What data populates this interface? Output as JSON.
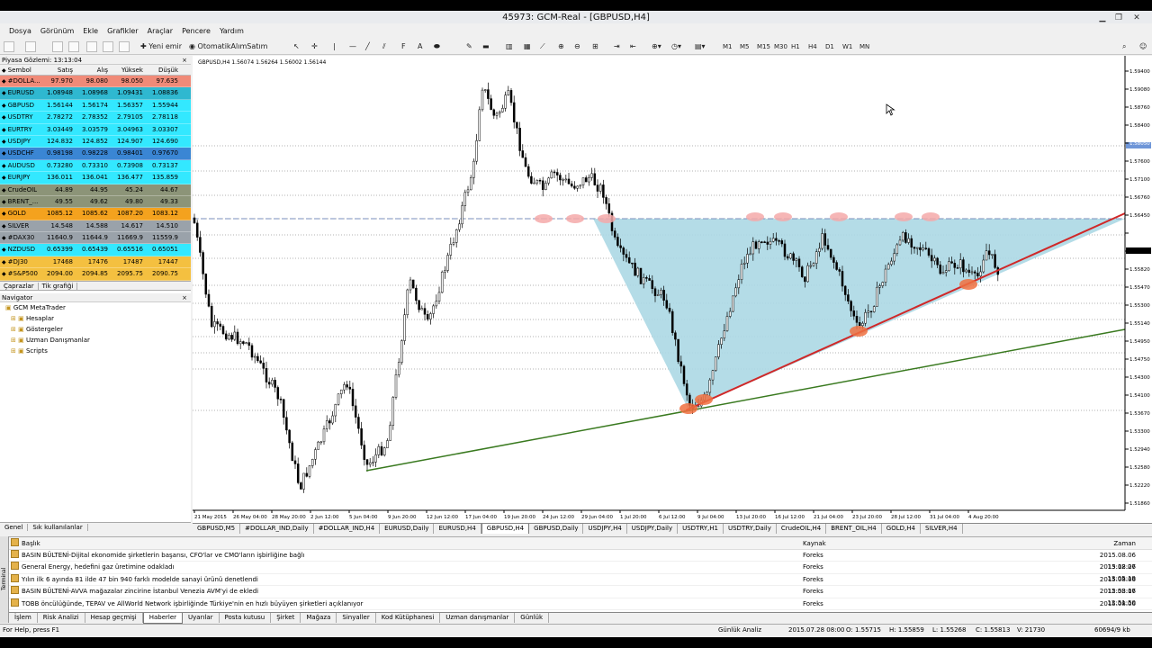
{
  "window": {
    "title": "45973: GCM-Real - [GBPUSD,H4]"
  },
  "menu": [
    "Dosya",
    "Görünüm",
    "Ekle",
    "Grafikler",
    "Araçlar",
    "Pencere",
    "Yardım"
  ],
  "toolbar": {
    "new_order": "Yeni emir",
    "auto_trading": "OtomatikAlımSatım",
    "timeframes": [
      "M1",
      "M5",
      "M15",
      "M30",
      "H1",
      "H4",
      "D1",
      "W1",
      "MN"
    ]
  },
  "market_watch": {
    "title": "Piyasa Gözlemi: 13:13:04",
    "headers": [
      "Sembol",
      "Satış",
      "Alış",
      "Yüksek",
      "Düşük"
    ],
    "rows": [
      {
        "s": "#DOLLA...",
        "b": "97.970",
        "a": "98.080",
        "h": "98.050",
        "l": "97.635",
        "bg": "#f08a78"
      },
      {
        "s": "EURUSD",
        "b": "1.08948",
        "a": "1.08968",
        "h": "1.09431",
        "l": "1.08836",
        "bg": "#2fb8d0"
      },
      {
        "s": "GBPUSD",
        "b": "1.56144",
        "a": "1.56174",
        "h": "1.56357",
        "l": "1.55944",
        "bg": "#33e8ff"
      },
      {
        "s": "USDTRY",
        "b": "2.78272",
        "a": "2.78352",
        "h": "2.79105",
        "l": "2.78118",
        "bg": "#33e8ff"
      },
      {
        "s": "EURTRY",
        "b": "3.03449",
        "a": "3.03579",
        "h": "3.04963",
        "l": "3.03307",
        "bg": "#33e8ff"
      },
      {
        "s": "USDJPY",
        "b": "124.832",
        "a": "124.852",
        "h": "124.907",
        "l": "124.690",
        "bg": "#33e8ff"
      },
      {
        "s": "USDCHF",
        "b": "0.98198",
        "a": "0.98228",
        "h": "0.98401",
        "l": "0.97670",
        "bg": "#3a86d4"
      },
      {
        "s": "AUDUSD",
        "b": "0.73280",
        "a": "0.73310",
        "h": "0.73908",
        "l": "0.73137",
        "bg": "#33e8ff"
      },
      {
        "s": "EURJPY",
        "b": "136.011",
        "a": "136.041",
        "h": "136.477",
        "l": "135.859",
        "bg": "#33e8ff"
      },
      {
        "s": "CrudeOIL",
        "b": "44.89",
        "a": "44.95",
        "h": "45.24",
        "l": "44.67",
        "bg": "#8c9478"
      },
      {
        "s": "BRENT_...",
        "b": "49.55",
        "a": "49.62",
        "h": "49.80",
        "l": "49.33",
        "bg": "#8c9478"
      },
      {
        "s": "GOLD",
        "b": "1085.12",
        "a": "1085.62",
        "h": "1087.20",
        "l": "1083.12",
        "bg": "#f4a21e"
      },
      {
        "s": "SILVER",
        "b": "14.548",
        "a": "14.588",
        "h": "14.617",
        "l": "14.510",
        "bg": "#9aa2aa"
      },
      {
        "s": "#DAX30",
        "b": "11640.9",
        "a": "11644.9",
        "h": "11669.9",
        "l": "11559.9",
        "bg": "#9aa2aa"
      },
      {
        "s": "NZDUSD",
        "b": "0.65399",
        "a": "0.65439",
        "h": "0.65516",
        "l": "0.65051",
        "bg": "#33e8ff"
      },
      {
        "s": "#DJ30",
        "b": "17468",
        "a": "17476",
        "h": "17487",
        "l": "17447",
        "bg": "#f4c040"
      },
      {
        "s": "#S&P500",
        "b": "2094.00",
        "a": "2094.85",
        "h": "2095.75",
        "l": "2090.75",
        "bg": "#f4c040"
      }
    ],
    "tabs": [
      "Çaprazlar",
      "Tik grafiği"
    ]
  },
  "navigator": {
    "title": "Navigator",
    "items": [
      "GCM MetaTrader",
      "Hesaplar",
      "Göstergeler",
      "Uzman Danışmanlar",
      "Scripts"
    ],
    "tabs": [
      "Genel",
      "Sık kullanılanlar"
    ]
  },
  "chart": {
    "info": "GBPUSD,H4  1.56074 1.56264 1.56002 1.56144",
    "price_labels": [
      "1.59400",
      "1.59080",
      "1.58760",
      "1.58400",
      "1.58050",
      "1.57600",
      "1.57100",
      "1.56760",
      "1.56450",
      "1.56144",
      "1.55980",
      "1.55820",
      "1.55470",
      "1.55300",
      "1.55140",
      "1.54950",
      "1.54750",
      "1.54300",
      "1.54100",
      "1.53670",
      "1.53300",
      "1.52940",
      "1.52580",
      "1.52220",
      "1.51860"
    ],
    "time_labels": [
      "21 May 2015",
      "26 May 04:00",
      "28 May 20:00",
      "2 Jun 12:00",
      "5 Jun 04:00",
      "9 Jun 20:00",
      "12 Jun 12:00",
      "17 Jun 04:00",
      "19 Jun 20:00",
      "24 Jun 12:00",
      "29 Jun 04:00",
      "1 Jul 20:00",
      "6 Jul 12:00",
      "9 Jul 04:00",
      "13 Jul 20:00",
      "16 Jul 12:00",
      "21 Jul 04:00",
      "23 Jul 20:00",
      "28 Jul 12:00",
      "31 Jul 04:00",
      "4 Aug 20:00"
    ]
  },
  "chart_tabs": [
    "GBPUSD,M5",
    "#DOLLAR_IND,Daily",
    "#DOLLAR_IND,H4",
    "EURUSD,Daily",
    "EURUSD,H4",
    "GBPUSD,H4",
    "GBPUSD,Daily",
    "USDJPY,H4",
    "USDJPY,Daily",
    "USDTRY,H1",
    "USDTRY,Daily",
    "CrudeOIL,H4",
    "BRENT_OIL,H4",
    "GOLD,H4",
    "SILVER,H4"
  ],
  "news": {
    "headers": [
      "Başlık",
      "Kaynak",
      "Zaman"
    ],
    "rows": [
      {
        "t": "BASIN BÜLTENİ-Dijital ekonomide şirketlerin başarısı, CFO'lar ve CMO'ların işbirliğine bağlı",
        "s": "Foreks",
        "z": "2015.08.06 13:12:27"
      },
      {
        "t": "General Energy, hedefini gaz üretimine odakladı",
        "s": "Foreks",
        "z": "2015.08.06 13:05:19"
      },
      {
        "t": "Yılın ilk 6 ayında 81 ilde 47 bin 940 farklı modelde sanayi ürünü denetlendi",
        "s": "Foreks",
        "z": "2015.08.06 12:53:17"
      },
      {
        "t": "BASIN BÜLTENİ-AVVA mağazalar zincirine İstanbul Venezia AVM'yi de ekledi",
        "s": "Foreks",
        "z": "2015.08.06 12:51:50"
      },
      {
        "t": "TOBB öncülüğünde, TEPAV ve AllWorld Network işbirliğinde Türkiye'nin en hızlı büyüyen şirketleri açıklanıyor",
        "s": "Foreks",
        "z": "2015.08.06 12:50:11"
      }
    ]
  },
  "bottom_tabs": [
    "İşlem",
    "Risk Analizi",
    "Hesap geçmişi",
    "Haberler",
    "Uyarılar",
    "Posta kutusu",
    "Şirket",
    "Mağaza",
    "Sinyaller",
    "Kod Kütüphanesi",
    "Uzman danışmanlar",
    "Günlük"
  ],
  "terminal_label": "Terminal",
  "status": {
    "help": "For Help, press F1",
    "profile": "Günlük Analiz",
    "time": "2015.07.28 08:00",
    "o": "O: 1.55715",
    "h": "H: 1.55859",
    "l": "L: 1.55268",
    "c": "C: 1.55813",
    "v": "V: 21730",
    "traffic": "60694/9 kb"
  }
}
